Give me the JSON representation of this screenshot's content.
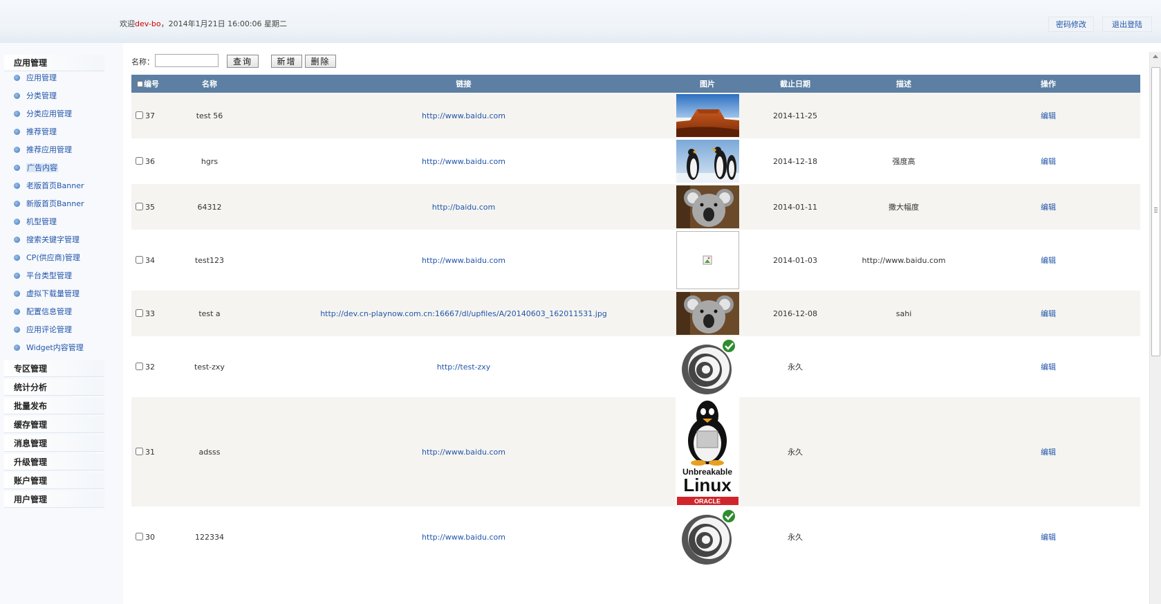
{
  "header": {
    "welcome_prefix": "欢迎",
    "user": "dev-bo",
    "datetime": "，2014年1月21日 16:00:06 星期二",
    "change_password": "密码修改",
    "logout": "退出登陆"
  },
  "sidebar": {
    "groups": [
      "应用管理",
      "专区管理",
      "统计分析",
      "批量发布",
      "缓存管理",
      "消息管理",
      "升级管理",
      "账户管理",
      "用户管理"
    ],
    "items": [
      "应用管理",
      "分类管理",
      "分类应用管理",
      "推荐管理",
      "推荐应用管理",
      "广告内容",
      "老版首页Banner",
      "新版首页Banner",
      "机型管理",
      "搜索关键字管理",
      "CP(供应商)管理",
      "平台类型管理",
      "虚拟下载量管理",
      "配置信息管理",
      "应用评论管理",
      "Widget内容管理"
    ],
    "active_item": "广告内容"
  },
  "search": {
    "label": "名称：",
    "value": "",
    "query": "查询",
    "add": "新增",
    "delete": "删除"
  },
  "table": {
    "headers": [
      "编号",
      "名称",
      "链接",
      "图片",
      "截止日期",
      "描述",
      "操作"
    ],
    "rows": [
      {
        "id": "37",
        "name": "test 56",
        "link": "http://www.baidu.com",
        "image": "desert",
        "date": "2014-11-25",
        "desc": "",
        "action": "编辑"
      },
      {
        "id": "36",
        "name": "hgrs",
        "link": "http://www.baidu.com",
        "image": "penguins",
        "date": "2014-12-18",
        "desc": "强度高",
        "action": "编辑"
      },
      {
        "id": "35",
        "name": "64312",
        "link": "http://baidu.com",
        "image": "koala",
        "date": "2014-01-11",
        "desc": "撒大幅度",
        "action": "编辑"
      },
      {
        "id": "34",
        "name": "test123",
        "link": "http://www.baidu.com",
        "image": "broken",
        "date": "2014-01-03",
        "desc": "http://www.baidu.com",
        "action": "编辑"
      },
      {
        "id": "33",
        "name": "test a",
        "link": "http://dev.cn-playnow.com.cn:16667/dl/upfiles/A/20140603_162011531.jpg",
        "image": "koala",
        "date": "2016-12-08",
        "desc": "sahi",
        "action": "编辑"
      },
      {
        "id": "32",
        "name": "test-zxy",
        "link": "http://test-zxy",
        "image": "spiral",
        "date": "永久",
        "desc": "",
        "action": "编辑"
      },
      {
        "id": "31",
        "name": "adsss",
        "link": "http://www.baidu.com",
        "image": "linux",
        "date": "永久",
        "desc": "",
        "action": "编辑"
      },
      {
        "id": "30",
        "name": "122334",
        "link": "http://www.baidu.com",
        "image": "spiral",
        "date": "永久",
        "desc": "",
        "action": "编辑"
      }
    ]
  },
  "images": {
    "linux_text_1": "Unbreakable",
    "linux_text_2": "Linux",
    "linux_text_3": "ORACLE"
  },
  "colors": {
    "header_row": "#5c7fa3",
    "link": "#2255aa",
    "user": "#d00000",
    "odd_row": "#f5f4f0"
  }
}
